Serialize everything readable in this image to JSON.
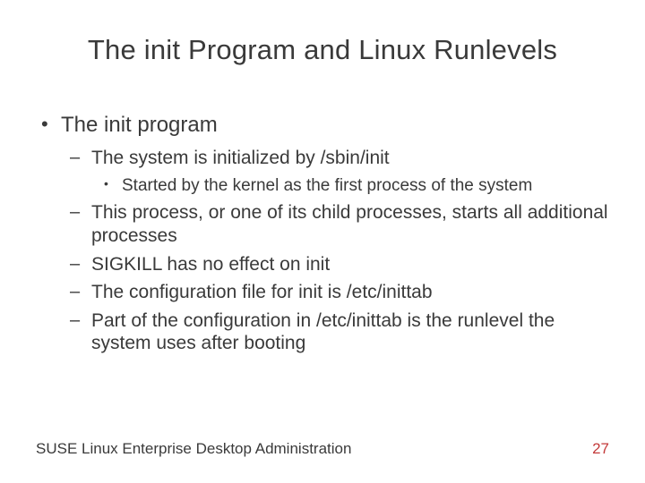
{
  "title": "The init Program and Linux Runlevels",
  "bullets": {
    "item1": "The init program",
    "sub1": "The system is initialized by /sbin/init",
    "subsub1": "Started by the kernel as the first process of the system",
    "sub2": "This process, or one of its child processes, starts all additional processes",
    "sub3": "SIGKILL has no effect on init",
    "sub4": "The configuration file for init is /etc/inittab",
    "sub5": "Part of the configuration in /etc/inittab is the runlevel the system uses after booting"
  },
  "footer": {
    "text": "SUSE Linux Enterprise Desktop Administration",
    "page": "27"
  }
}
